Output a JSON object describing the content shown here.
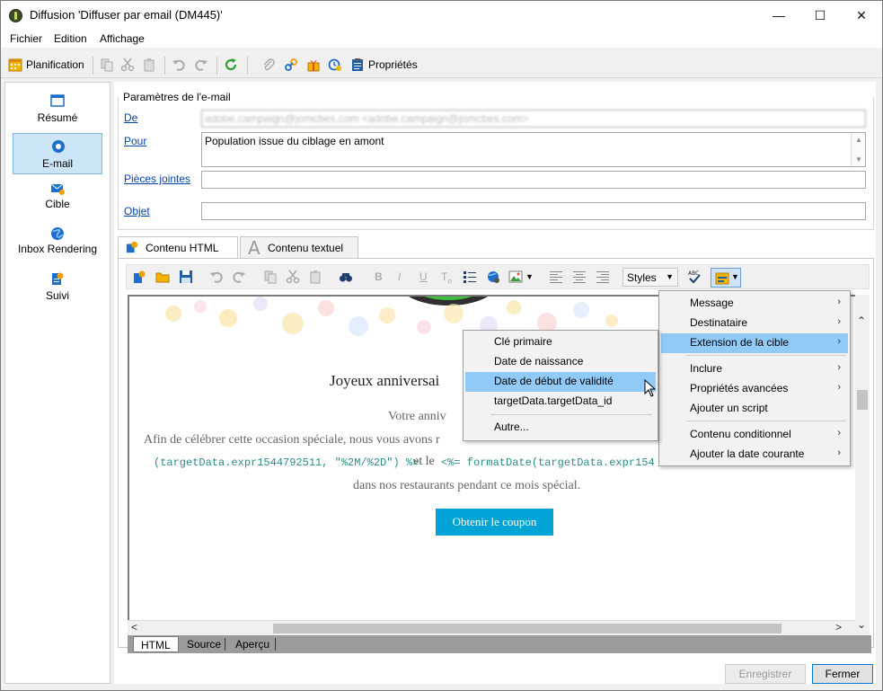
{
  "window": {
    "title": "Diffusion 'Diffuser par email (DM445)'",
    "controls": {
      "minimize": "—",
      "maximize": "☐",
      "close": "✕"
    }
  },
  "menubar": [
    "Fichier",
    "Edition",
    "Affichage"
  ],
  "toolbar": {
    "schedule_label": "Planification",
    "properties_label": "Propriétés"
  },
  "leftnav": {
    "items": [
      {
        "label": "Résumé",
        "icon": "summary-icon"
      },
      {
        "label": "E-mail",
        "icon": "email-icon"
      },
      {
        "label": "Cible",
        "icon": "target-icon"
      },
      {
        "label": "Inbox Rendering",
        "icon": "globe-icon"
      },
      {
        "label": "Suivi",
        "icon": "tracking-icon"
      }
    ],
    "active": "E-mail"
  },
  "email_params": {
    "group_title": "Paramètres de l'e-mail",
    "from_label": "De",
    "from_value": "adobe.campaign@jomcbes.com <adobe.campaign@jomcbes.com>",
    "to_label": "Pour",
    "to_value": "Population issue du ciblage en amont",
    "attachments_label": "Pièces jointes",
    "subject_label": "Objet"
  },
  "content_tabs": {
    "html": "Contenu HTML",
    "text": "Contenu textuel"
  },
  "editor": {
    "styles_label": "Styles",
    "preview": {
      "heading": "Joyeux anniversai",
      "line1": "Votre anniv",
      "line2": "Afin de célébrer cette occasion spéciale, nous vous avons r",
      "code1": "(targetData.expr1544792511, \"%2M/%2D\") %>",
      "et_le": "et le",
      "code2": "<%= formatDate(targetData.expr154",
      "line3": "dans nos restaurants pendant ce mois spécial.",
      "button": "Obtenir le coupon"
    },
    "bottom_tabs": [
      "HTML",
      "Source",
      "Aperçu"
    ]
  },
  "context_menu": {
    "items": [
      {
        "label": "Message",
        "submenu": true
      },
      {
        "label": "Destinataire",
        "submenu": true
      },
      {
        "label": "Extension de la cible",
        "submenu": true,
        "highlighted": true
      },
      {
        "label": "Inclure",
        "submenu": true
      },
      {
        "label": "Propriétés avancées",
        "submenu": true
      },
      {
        "label": "Ajouter un script",
        "submenu": false
      },
      {
        "label": "Contenu conditionnel",
        "submenu": true
      },
      {
        "label": "Ajouter la date courante",
        "submenu": true
      }
    ]
  },
  "submenu": {
    "items": [
      {
        "label": "Clé primaire"
      },
      {
        "label": "Date de naissance"
      },
      {
        "label": "Date de début de validité",
        "highlighted": true
      },
      {
        "label": "targetData.targetData_id"
      },
      {
        "label": "Autre..."
      }
    ]
  },
  "footer": {
    "save_label": "Enregistrer",
    "close_label": "Fermer"
  },
  "colors": {
    "accent": "#00a3d6",
    "highlight": "#91c9f7",
    "link": "#0645ad"
  }
}
